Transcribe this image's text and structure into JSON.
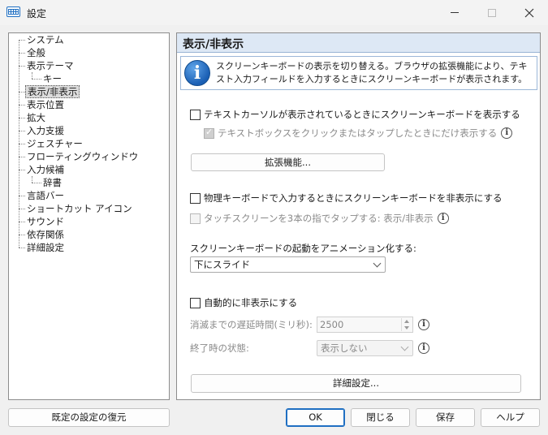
{
  "window": {
    "title": "設定"
  },
  "tree": {
    "items": [
      {
        "label": "システム"
      },
      {
        "label": "全般"
      },
      {
        "label": "表示テーマ"
      },
      {
        "label": "キー"
      },
      {
        "label": "表示/非表示"
      },
      {
        "label": "表示位置"
      },
      {
        "label": "拡大"
      },
      {
        "label": "入力支援"
      },
      {
        "label": "ジェスチャー"
      },
      {
        "label": "フローティングウィンドウ"
      },
      {
        "label": "入力候補"
      },
      {
        "label": "辞書"
      },
      {
        "label": "言語バー"
      },
      {
        "label": "ショートカット アイコン"
      },
      {
        "label": "サウンド"
      },
      {
        "label": "依存関係"
      },
      {
        "label": "詳細設定"
      }
    ],
    "selected": "表示/非表示"
  },
  "panel": {
    "title": "表示/非表示",
    "info": "スクリーンキーボードの表示を切り替える。ブラウザの拡張機能により、テキスト入力フィールドを入力するときにスクリーンキーボードが表示されます。",
    "show_on_text_cursor": {
      "label": "テキストカーソルが表示されているときにスクリーンキーボードを表示する",
      "checked": false
    },
    "only_on_tap": {
      "label": "テキストボックスをクリックまたはタップしたときにだけ表示する",
      "checked": true,
      "disabled": true
    },
    "extensions_button": "拡張機能...",
    "hide_on_physical_keyboard": {
      "label": "物理キーボードで入力するときにスクリーンキーボードを非表示にする",
      "checked": false
    },
    "three_finger_tap": {
      "label": "タッチスクリーンを3本の指でタップする: 表示/非表示",
      "checked": false,
      "disabled": true
    },
    "animation_label": "スクリーンキーボードの起動をアニメーション化する:",
    "animation_value": "下にスライド",
    "auto_hide": {
      "label": "自動的に非表示にする",
      "checked": false
    },
    "delay_label": "消滅までの遅延時間(ミリ秒):",
    "delay_value": "2500",
    "end_state_label": "終了時の状態:",
    "end_state_value": "表示しない",
    "advanced_button": "詳細設定..."
  },
  "footer": {
    "restore_defaults": "既定の設定の復元",
    "ok": "OK",
    "close": "閉じる",
    "save": "保存",
    "help": "ヘルプ"
  },
  "colors": {
    "accent": "#1f6fc2",
    "header_bg": "#dde8f5"
  }
}
